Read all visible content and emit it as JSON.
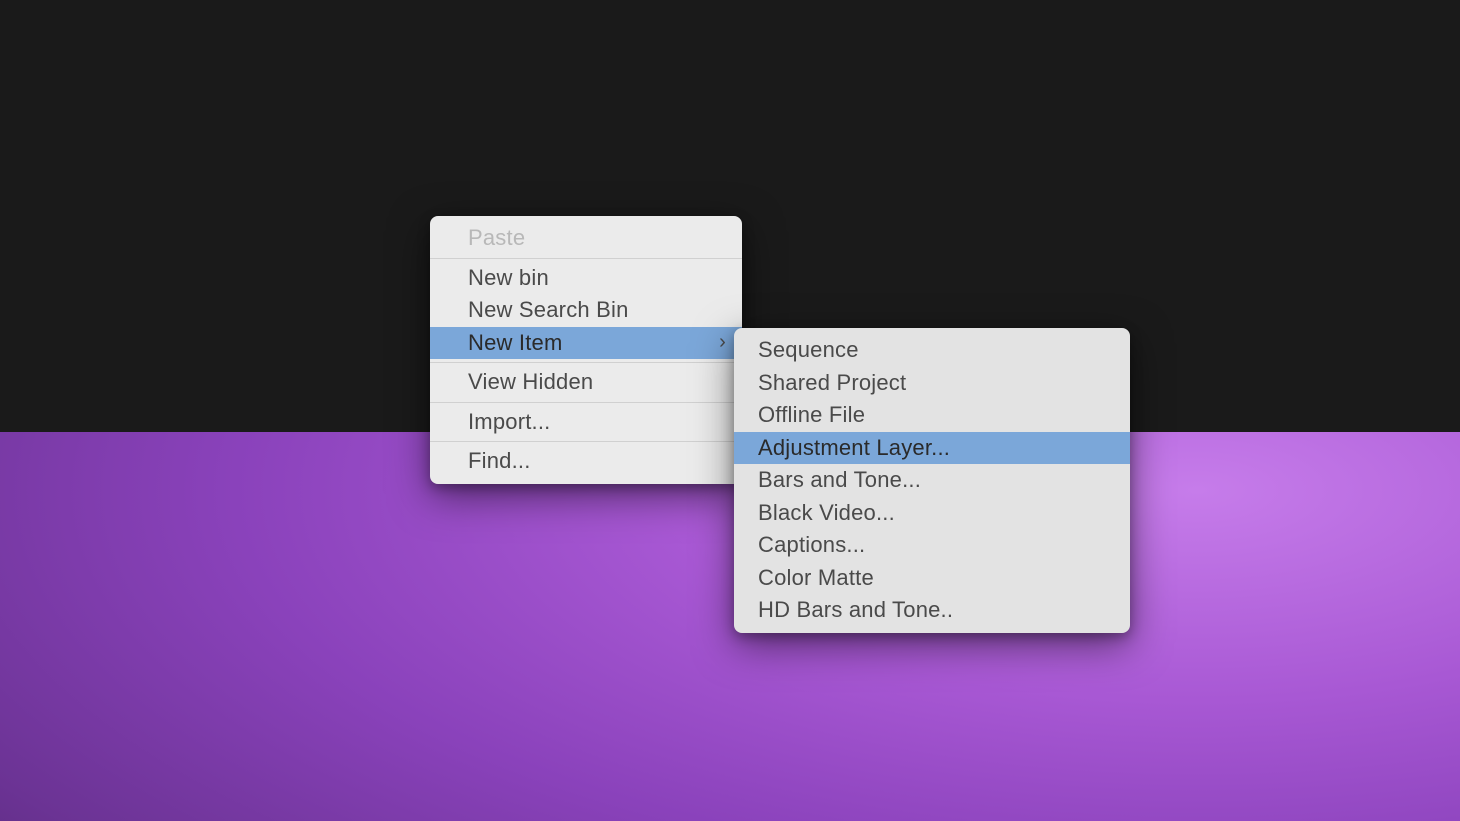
{
  "primaryMenu": {
    "items": [
      {
        "label": "Paste",
        "disabled": true
      },
      {
        "label": "New bin"
      },
      {
        "label": "New Search Bin"
      },
      {
        "label": "New Item",
        "highlighted": true,
        "hasSubmenu": true
      },
      {
        "label": "View Hidden"
      },
      {
        "label": "Import..."
      },
      {
        "label": "Find..."
      }
    ]
  },
  "secondaryMenu": {
    "items": [
      {
        "label": "Sequence"
      },
      {
        "label": "Shared Project"
      },
      {
        "label": "Offline File"
      },
      {
        "label": "Adjustment Layer...",
        "highlighted": true
      },
      {
        "label": "Bars and Tone..."
      },
      {
        "label": "Black Video..."
      },
      {
        "label": "Captions..."
      },
      {
        "label": "Color Matte"
      },
      {
        "label": "HD Bars and Tone.."
      }
    ]
  }
}
